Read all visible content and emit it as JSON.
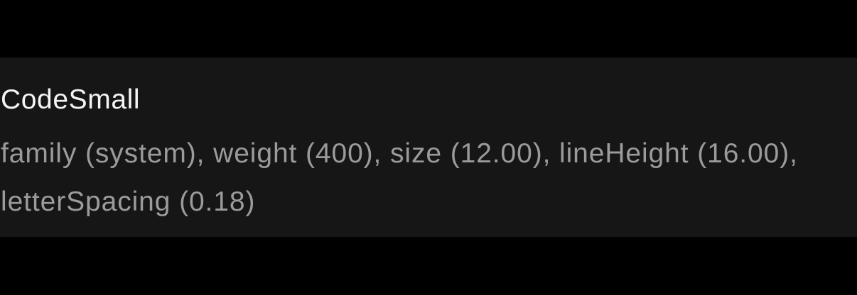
{
  "token": {
    "name": "CodeSmall",
    "description": "family (system), weight (400), size (12.00), lineHeight (16.00), letterSpacing (0.18)"
  },
  "colors": {
    "background": "#000000",
    "card": "#161616",
    "title": "#f4f4f4",
    "description": "#9b9b9b"
  }
}
